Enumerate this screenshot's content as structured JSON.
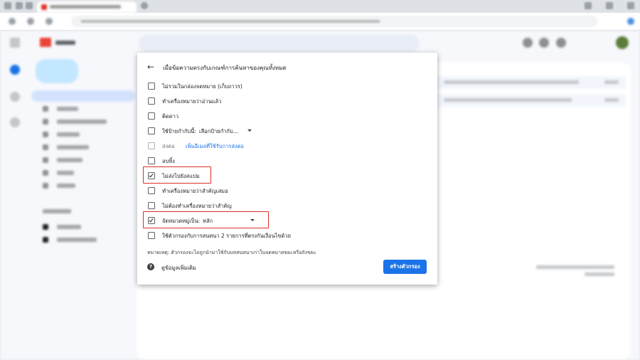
{
  "dialog": {
    "header": "เมื่อข้อความตรงกับเกณฑ์การค้นหาของคุณทั้งหมด",
    "options": [
      {
        "label": "ไม่รวมในกล่องจดหมาย (เก็บถาวร)",
        "checked": false
      },
      {
        "label": "ทำเครื่องหมายว่าอ่านแล้ว",
        "checked": false
      },
      {
        "label": "ติดดาว",
        "checked": false
      },
      {
        "label": "ใช้ป้ายกำกับนี้:",
        "checked": false,
        "select_value": "เลือกป้ายกำกับ..."
      },
      {
        "label": "ส่งต่อ",
        "checked": false,
        "disabled": true,
        "link": "เพิ่มอีเมลที่ใช้รับการส่งต่อ"
      },
      {
        "label": "ลบทิ้ง",
        "checked": false
      },
      {
        "label": "ไม่ส่งไปยังสแปม",
        "checked": true,
        "highlighted": true
      },
      {
        "label": "ทำเครื่องหมายว่าสำคัญเสมอ",
        "checked": false
      },
      {
        "label": "ไม่ต้องทำเครื่องหมายว่าสำคัญ",
        "checked": false
      },
      {
        "label": "จัดหมวดหมู่เป็น:",
        "checked": true,
        "highlighted": true,
        "select_value": "หลัก"
      },
      {
        "label": "ใช้ตัวกรองกับการสนทนา 2 รายการที่ตรงกันเงื่อนไขด้วย",
        "checked": false
      }
    ],
    "note": "หมายเหตุ: ตัวกรองจะไม่ถูกนำมาใช้กับบทสนทนาเก่าในจดหมายขยะหรือถังขยะ",
    "help_label": "ดูข้อมูลเพิ่มเติม",
    "create_button": "สร้างตัวกรอง"
  },
  "colors": {
    "highlight": "#d93025",
    "primary": "#1a73e8",
    "link": "#1a73e8"
  },
  "icons": {
    "back": "arrow-left-icon",
    "help": "question-mark-icon",
    "dropdown": "caret-down-icon"
  }
}
